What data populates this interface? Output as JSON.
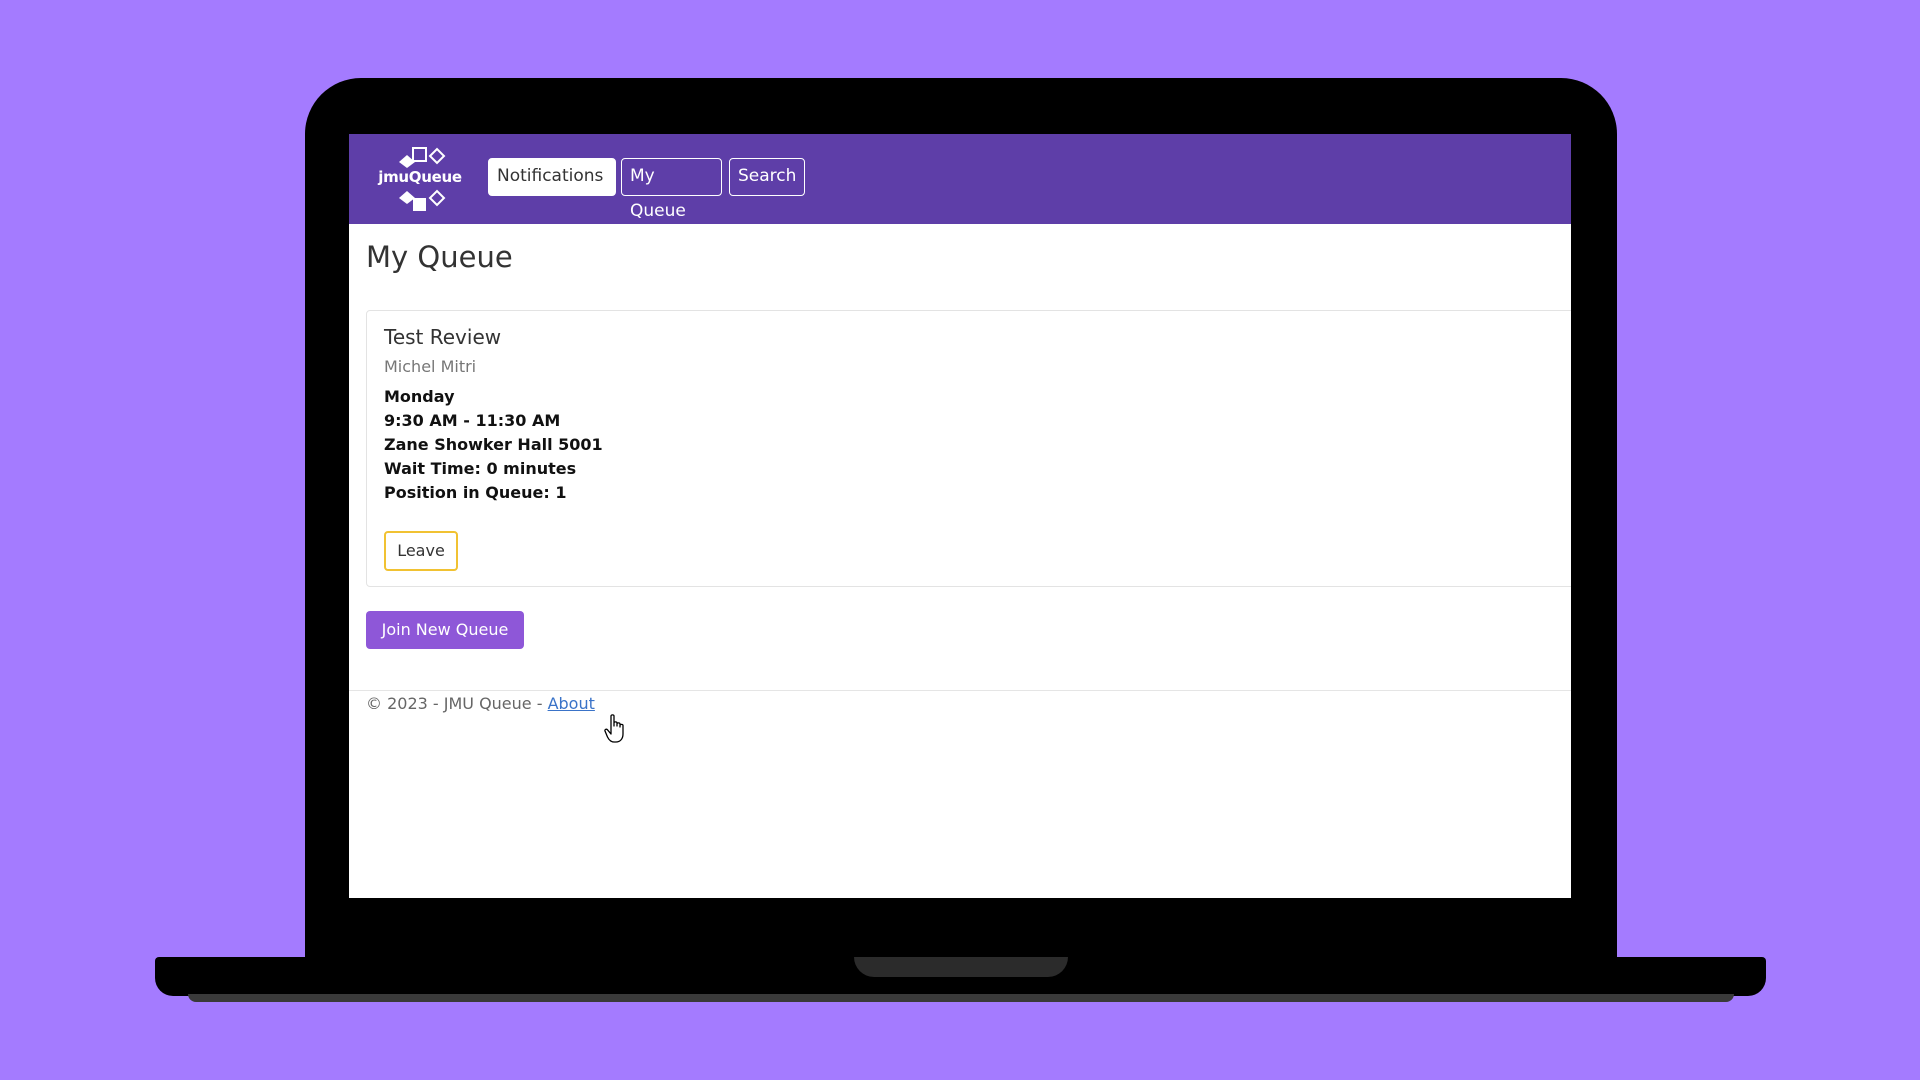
{
  "app": {
    "logo_text": "jmuQueue",
    "colors": {
      "background": "#a47bff",
      "navbar": "#5e3ea8",
      "primary_button": "#8e57d8",
      "warning_border": "#f1c232",
      "link": "#3a73c8"
    }
  },
  "nav": {
    "notifications": "Notifications",
    "my_queue": "My Queue",
    "search": "Search"
  },
  "page": {
    "title": "My Queue"
  },
  "queue_card": {
    "title": "Test Review",
    "instructor": "Michel Mitri",
    "day": "Monday",
    "time": "9:30 AM - 11:30 AM",
    "location": "Zane Showker Hall 5001",
    "wait_time": "Wait Time: 0 minutes",
    "position": "Position in Queue: 1",
    "leave_label": "Leave"
  },
  "actions": {
    "join_label": "Join New Queue"
  },
  "footer": {
    "copyright": "© 2023 - JMU Queue - ",
    "about_label": "About"
  },
  "icons": {
    "logo": "jmuqueue-logo-icon",
    "cursor": "hand-pointer-icon"
  }
}
